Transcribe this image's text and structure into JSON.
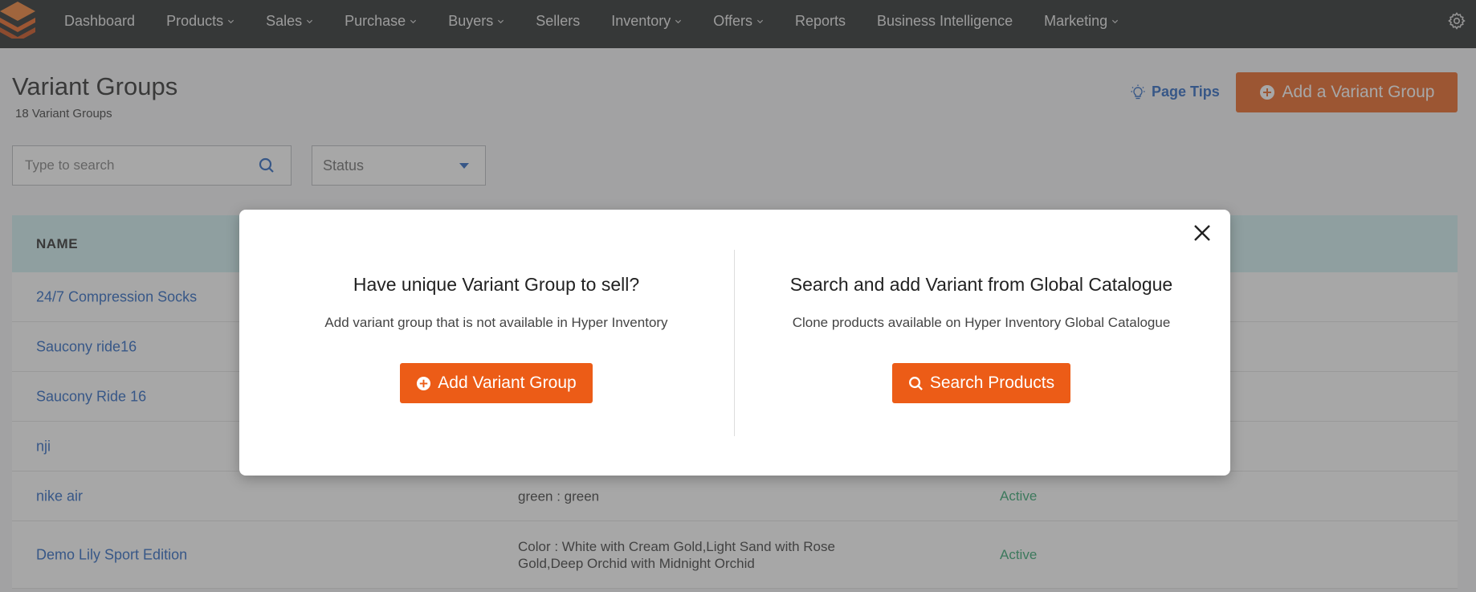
{
  "nav": {
    "items": [
      {
        "label": "Dashboard",
        "dropdown": false
      },
      {
        "label": "Products",
        "dropdown": true
      },
      {
        "label": "Sales",
        "dropdown": true
      },
      {
        "label": "Purchase",
        "dropdown": true
      },
      {
        "label": "Buyers",
        "dropdown": true
      },
      {
        "label": "Sellers",
        "dropdown": false
      },
      {
        "label": "Inventory",
        "dropdown": true
      },
      {
        "label": "Offers",
        "dropdown": true
      },
      {
        "label": "Reports",
        "dropdown": false
      },
      {
        "label": "Business Intelligence",
        "dropdown": false
      },
      {
        "label": "Marketing",
        "dropdown": true
      }
    ],
    "settings_icon": "gear-icon"
  },
  "header": {
    "title": "Variant Groups",
    "subtitle": "18 Variant Groups",
    "page_tips_label": "Page Tips",
    "add_button_label": "Add a Variant Group"
  },
  "filters": {
    "search_placeholder": "Type to search",
    "search_value": "",
    "status_label": "Status"
  },
  "table": {
    "columns": [
      "NAME"
    ],
    "rows": [
      {
        "name": "24/7 Compression Socks",
        "variant": "",
        "status": ""
      },
      {
        "name": "Saucony ride16",
        "variant": "",
        "status": ""
      },
      {
        "name": "Saucony Ride 16",
        "variant": "",
        "status": ""
      },
      {
        "name": "nji",
        "variant": "",
        "status": ""
      },
      {
        "name": "nike air",
        "variant": "green : green",
        "status": "Active"
      },
      {
        "name": "Demo Lily Sport Edition",
        "variant": "Color : White with Cream Gold,Light Sand with Rose Gold,Deep Orchid with Midnight Orchid",
        "status": "Active"
      }
    ]
  },
  "modal": {
    "left": {
      "title": "Have unique Variant Group to sell?",
      "description": "Add variant group that is not available in Hyper Inventory",
      "button_label": "Add Variant Group"
    },
    "right": {
      "title": "Search and add Variant from Global Catalogue",
      "description": "Clone products available on Hyper Inventory Global Catalogue",
      "button_label": "Search Products"
    }
  },
  "colors": {
    "accent": "#ec5c17",
    "link": "#1f5fbf",
    "active": "#2aa36b",
    "nav_bg": "#1d2021",
    "table_header_bg": "#cfeff1"
  }
}
